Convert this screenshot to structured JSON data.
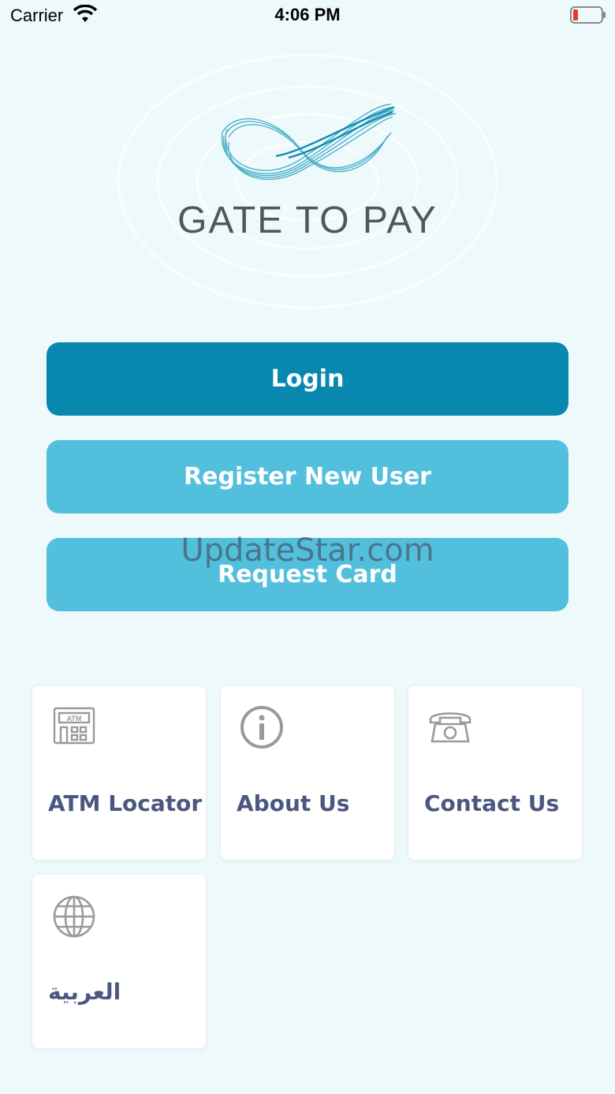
{
  "status_bar": {
    "carrier": "Carrier",
    "time": "4:06 PM"
  },
  "brand": {
    "name": "GATE TO PAY"
  },
  "buttons": {
    "login": "Login",
    "register": "Register New User",
    "request_card": "Request Card"
  },
  "watermark": "UpdateStar.com",
  "tiles": [
    {
      "label": "ATM Locator",
      "icon": "atm-icon"
    },
    {
      "label": "About Us",
      "icon": "info-icon"
    },
    {
      "label": "Contact Us",
      "icon": "telephone-icon"
    },
    {
      "label": "العربية",
      "icon": "globe-icon"
    }
  ],
  "colors": {
    "primary": "#0888ae",
    "secondary": "#52bfdd",
    "tile_text": "#4a5780",
    "background": "#eef9fc"
  }
}
